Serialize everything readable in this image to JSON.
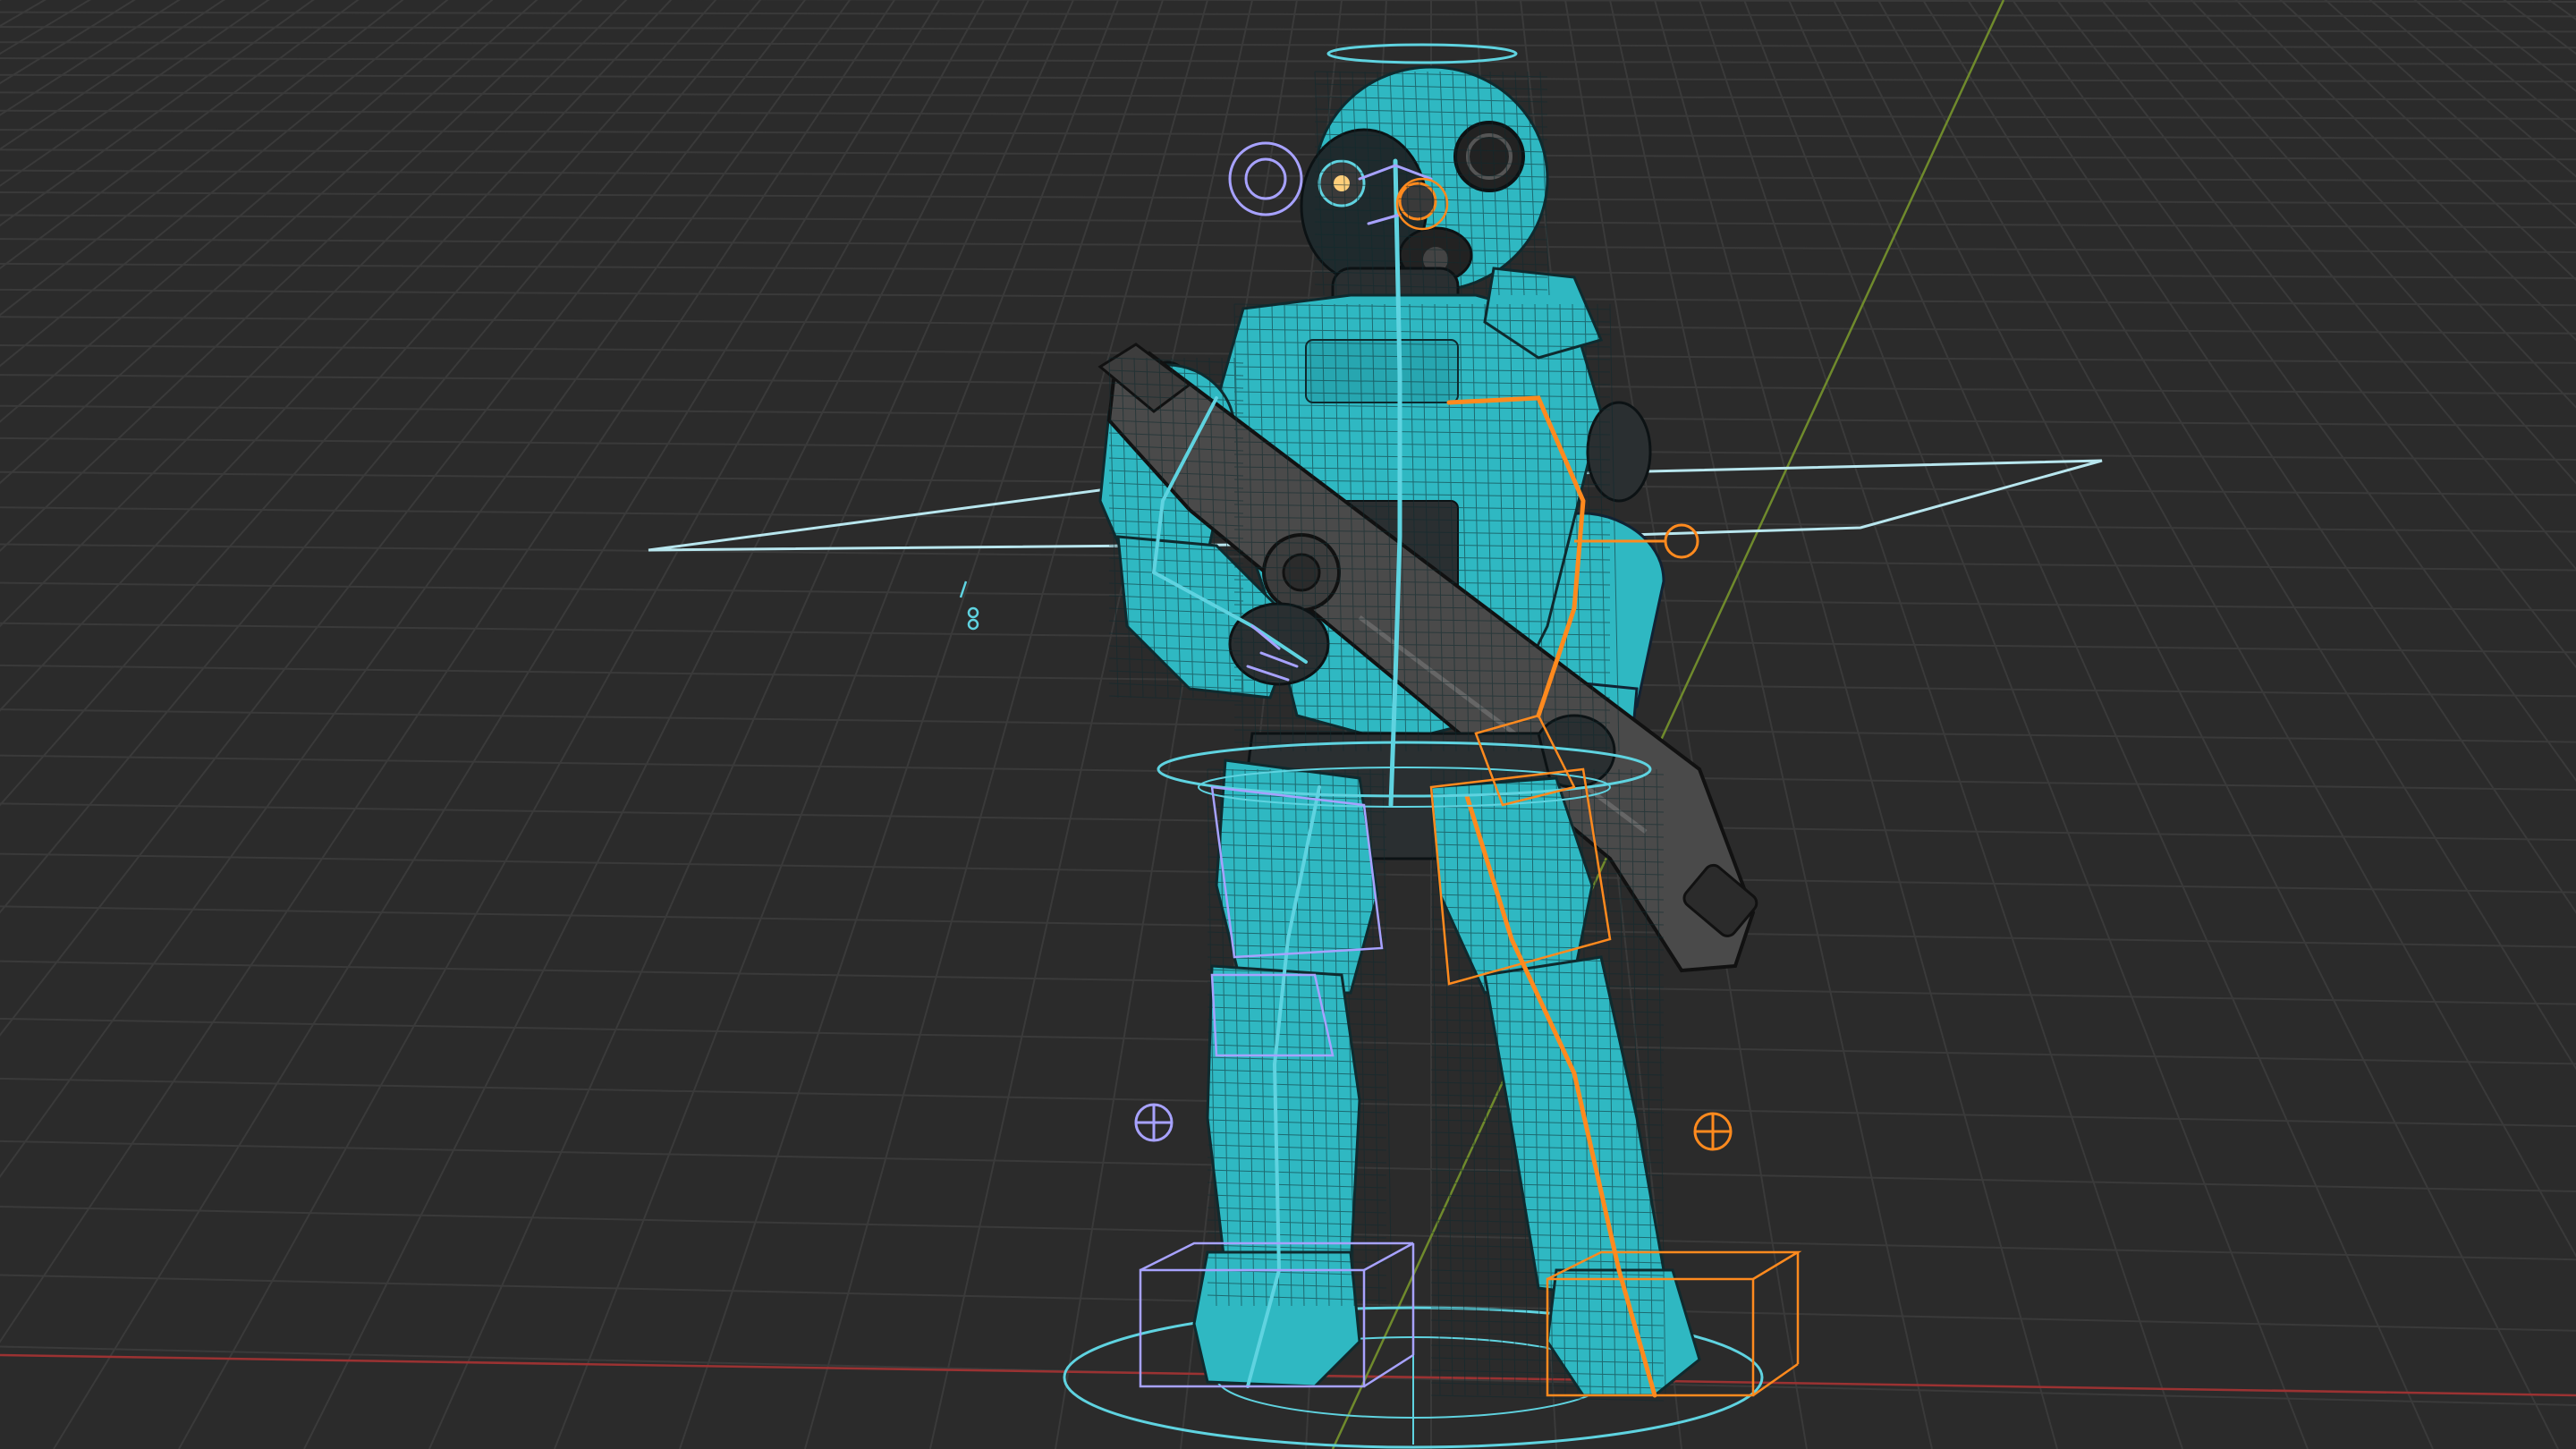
{
  "viewport": {
    "kind": "3d-viewport",
    "shading": "wireframe-overlay",
    "subject": "armored-soldier-character-rig",
    "colors": {
      "background": "#2b2b2b",
      "grid": "#3a3a3a",
      "x_axis": "#9b3232",
      "y_axis": "#6f8a2c",
      "armor": "#2fb8c2",
      "armor_dark": "#1d7c86",
      "bones_left": "#5fd3e0",
      "bones_right": "#ff8a1e",
      "controls_neutral": "#a7a2ff",
      "weapon": "#4a4a4a"
    }
  },
  "rig_controls": [
    {
      "name": "root-circle",
      "side": "center"
    },
    {
      "name": "hip-ring",
      "side": "center"
    },
    {
      "name": "torso-plane",
      "side": "center"
    },
    {
      "name": "head-halo",
      "side": "center"
    },
    {
      "name": "foot-box-left",
      "side": "left"
    },
    {
      "name": "foot-box-right",
      "side": "right"
    },
    {
      "name": "knee-pole-left",
      "side": "left"
    },
    {
      "name": "knee-pole-right",
      "side": "right"
    }
  ]
}
